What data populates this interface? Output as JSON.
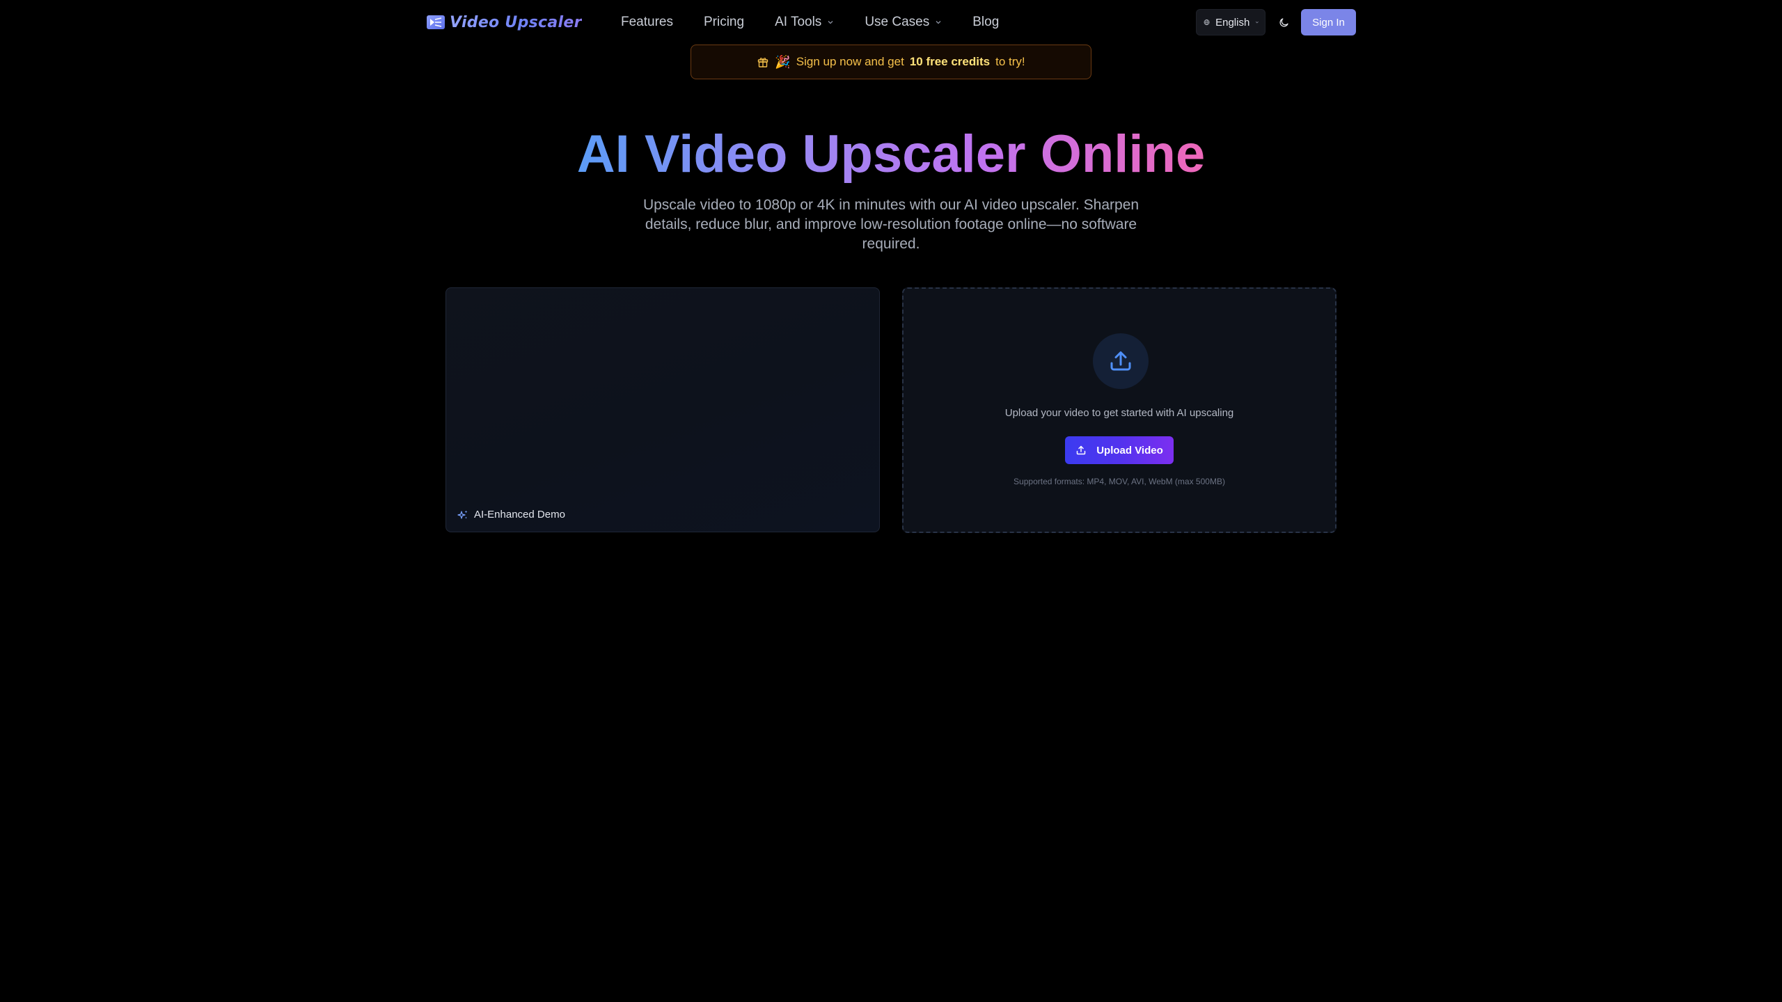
{
  "header": {
    "brand_name": "Video Upscaler",
    "nav": [
      {
        "label": "Features",
        "has_dropdown": false
      },
      {
        "label": "Pricing",
        "has_dropdown": false
      },
      {
        "label": "AI Tools",
        "has_dropdown": true
      },
      {
        "label": "Use Cases",
        "has_dropdown": true
      },
      {
        "label": "Blog",
        "has_dropdown": false
      }
    ],
    "language": "English",
    "theme_icon": "moon-icon",
    "signin_label": "Sign In"
  },
  "promo": {
    "icon": "gift-icon",
    "emoji": "🎉",
    "text_before": "Sign up now and get",
    "highlight": "10 free credits",
    "text_after": "to try!"
  },
  "hero": {
    "title": "AI Video Upscaler Online",
    "subtitle": "Upscale video to 1080p or 4K in minutes with our AI video upscaler. Sharpen details, reduce blur, and improve low-resolution footage online—no software required."
  },
  "demo": {
    "badge_icon": "sparkles-icon",
    "badge_label": "AI-Enhanced Demo"
  },
  "upload": {
    "icon": "upload-icon",
    "hint": "Upload your video to get started with AI upscaling",
    "button_label": "Upload Video",
    "formats": "Supported formats: MP4, MOV, AVI, WebM (max 500MB)"
  },
  "colors": {
    "background": "#000000",
    "accent": "#7b85e8",
    "promo_text": "#f5c04a",
    "upload_button_start": "#3b3bf0",
    "upload_button_end": "#7c2ff0",
    "title_gradient_start": "#5b9cf6",
    "title_gradient_end": "#ee67b9"
  }
}
